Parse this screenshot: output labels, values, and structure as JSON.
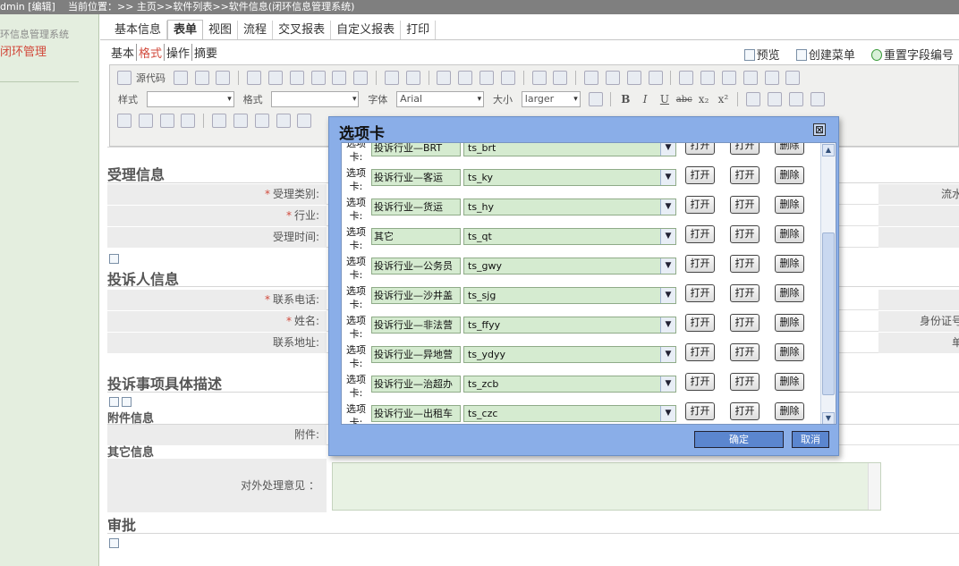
{
  "topbar": {
    "user": "dmin [编辑]",
    "breadcrumb": "当前位置：>> 主页>>软件列表>>软件信息(闭环信息管理系统)"
  },
  "sidebar": {
    "system": "环信息管理系统",
    "manage": "闭环管理"
  },
  "tabs": [
    {
      "label": "基本信息",
      "active": false
    },
    {
      "label": "表单",
      "active": true
    },
    {
      "label": "视图",
      "active": false
    },
    {
      "label": "流程",
      "active": false
    },
    {
      "label": "交叉报表",
      "active": false
    },
    {
      "label": "自定义报表",
      "active": false
    },
    {
      "label": "打印",
      "active": false
    }
  ],
  "subtabs": [
    {
      "label": "基本",
      "active": false
    },
    {
      "label": "格式",
      "active": true
    },
    {
      "label": "操作",
      "active": false
    },
    {
      "label": "摘要",
      "active": false
    }
  ],
  "actions": {
    "preview": "预览",
    "create_menu": "创建菜单",
    "reset_field_numbers": "重置字段编号"
  },
  "editor": {
    "source": "源代码",
    "style_label": "样式",
    "format_label": "格式",
    "font_label": "字体",
    "font_value": "Arial",
    "size_label": "大小",
    "size_value": "larger",
    "bold": "B",
    "italic": "I",
    "underline": "U",
    "strike": "abc",
    "sub": "x₂",
    "sup": "x²"
  },
  "form": {
    "section1": "受理信息",
    "accept_type": "受理类别:",
    "industry": "行业:",
    "accept_time": "受理时间:",
    "serial": "流水",
    "section2": "投诉人信息",
    "phone": "联系电话:",
    "name": "姓名:",
    "address": "联系地址:",
    "idcard": "身份证号",
    "unit": "单",
    "section3": "投诉事项具体描述",
    "attach_section": "附件信息",
    "attach": "附件:",
    "other_section": "其它信息",
    "external_opinion": "对外处理意见 ：",
    "approve_section": "审批"
  },
  "modal": {
    "title": "选项卡",
    "close": "⊠",
    "option_label": "选项卡:",
    "ok": "确定",
    "cancel": "取消",
    "open": "打开",
    "delete": "删除",
    "rows": [
      {
        "name": "投诉行业—BRT",
        "code": "ts_brt"
      },
      {
        "name": "投诉行业—客运",
        "code": "ts_ky"
      },
      {
        "name": "投诉行业—货运",
        "code": "ts_hy"
      },
      {
        "name": "其它",
        "code": "ts_qt"
      },
      {
        "name": "投诉行业—公务员",
        "code": "ts_gwy"
      },
      {
        "name": "投诉行业—沙井盖",
        "code": "ts_sjg"
      },
      {
        "name": "投诉行业—非法营",
        "code": "ts_ffyy"
      },
      {
        "name": "投诉行业—异地营",
        "code": "ts_ydyy"
      },
      {
        "name": "投诉行业—治超办",
        "code": "ts_zcb"
      },
      {
        "name": "投诉行业—出租车",
        "code": "ts_czc"
      }
    ]
  }
}
